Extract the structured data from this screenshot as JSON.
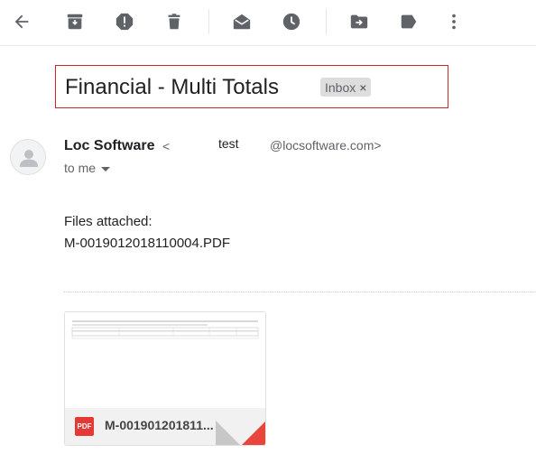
{
  "toolbar": {
    "icons": [
      "back-arrow-icon",
      "archive-icon",
      "report-spam-icon",
      "delete-icon",
      "mark-unread-icon",
      "snooze-icon",
      "move-to-icon",
      "labels-icon",
      "more-vert-icon"
    ],
    "icon_color": "#5f6368"
  },
  "email": {
    "subject": "Financial - Multi Totals",
    "label": "Inbox",
    "label_remove": "×",
    "sender": {
      "name": "Loc Software",
      "lt": "<",
      "user": "test",
      "domain": "@locsoftware.com>"
    },
    "recipient": "to me",
    "body": {
      "line1": "Files attached:",
      "line2": "M-0019012018110004.PDF"
    }
  },
  "attachment": {
    "type_badge": "PDF",
    "file_name": "M-001901201811...",
    "badge_color": "#e53935"
  },
  "colors": {
    "highlight_border": "#d0262b",
    "chip_bg": "#dddddd"
  }
}
